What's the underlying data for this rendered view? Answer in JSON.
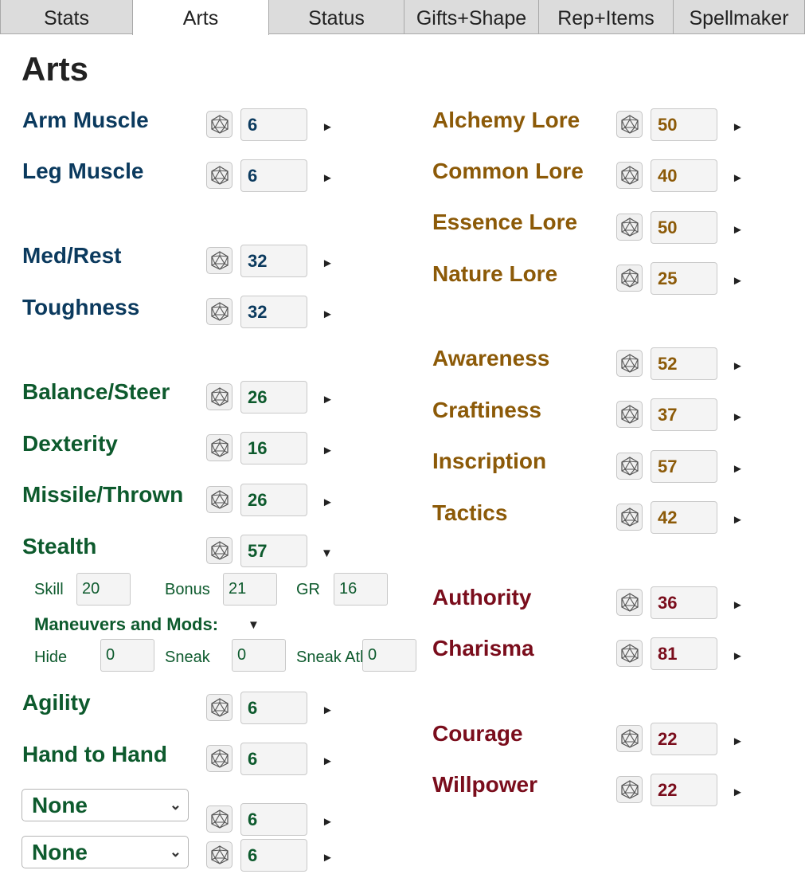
{
  "tabs": [
    "Stats",
    "Arts",
    "Status",
    "Gifts+Shape",
    "Rep+Items",
    "Spellmaker"
  ],
  "title": "Arts",
  "left": {
    "arm_muscle": {
      "label": "Arm Muscle",
      "value": "6"
    },
    "leg_muscle": {
      "label": "Leg Muscle",
      "value": "6"
    },
    "med_rest": {
      "label": "Med/Rest",
      "value": "32"
    },
    "toughness": {
      "label": "Toughness",
      "value": "32"
    },
    "balance": {
      "label": "Balance/Steer",
      "value": "26"
    },
    "dexterity": {
      "label": "Dexterity",
      "value": "16"
    },
    "missile": {
      "label": "Missile/Thrown",
      "value": "26"
    },
    "stealth": {
      "label": "Stealth",
      "value": "57"
    },
    "agility": {
      "label": "Agility",
      "value": "6"
    },
    "hand_to_hand": {
      "label": "Hand to Hand",
      "value": "6"
    },
    "select1": {
      "selected": "None",
      "value": "6"
    },
    "select2": {
      "selected": "None",
      "value": "6"
    }
  },
  "stealth_detail": {
    "skill_label": "Skill",
    "skill_value": "20",
    "bonus_label": "Bonus",
    "bonus_value": "21",
    "gr_label": "GR",
    "gr_value": "16",
    "maneuvers_label": "Maneuvers and Mods:",
    "hide_label": "Hide",
    "hide_value": "0",
    "sneak_label": "Sneak",
    "sneak_value": "0",
    "sneak_atk_label": "Sneak Atk",
    "sneak_atk_value": "0"
  },
  "right": {
    "alchemy": {
      "label": "Alchemy Lore",
      "value": "50"
    },
    "common": {
      "label": "Common Lore",
      "value": "40"
    },
    "essence": {
      "label": "Essence Lore",
      "value": "50"
    },
    "nature": {
      "label": "Nature Lore",
      "value": "25"
    },
    "awareness": {
      "label": "Awareness",
      "value": "52"
    },
    "craftiness": {
      "label": "Craftiness",
      "value": "37"
    },
    "inscription": {
      "label": "Inscription",
      "value": "57"
    },
    "tactics": {
      "label": "Tactics",
      "value": "42"
    },
    "authority": {
      "label": "Authority",
      "value": "36"
    },
    "charisma": {
      "label": "Charisma",
      "value": "81"
    },
    "courage": {
      "label": "Courage",
      "value": "22"
    },
    "willpower": {
      "label": "Willpower",
      "value": "22"
    }
  },
  "colors": {
    "blue": "#0b3a5e",
    "green": "#0d5a2d",
    "gold": "#8c5a08",
    "red": "#7a0d1c"
  },
  "icons": {
    "dice": "d20-dice-icon",
    "collapsed": "triangle-right-icon",
    "expanded": "triangle-down-icon",
    "select": "chevron-down-icon"
  },
  "glyphs": {
    "collapsed": "►",
    "expanded": "▼",
    "select": "⌄"
  }
}
